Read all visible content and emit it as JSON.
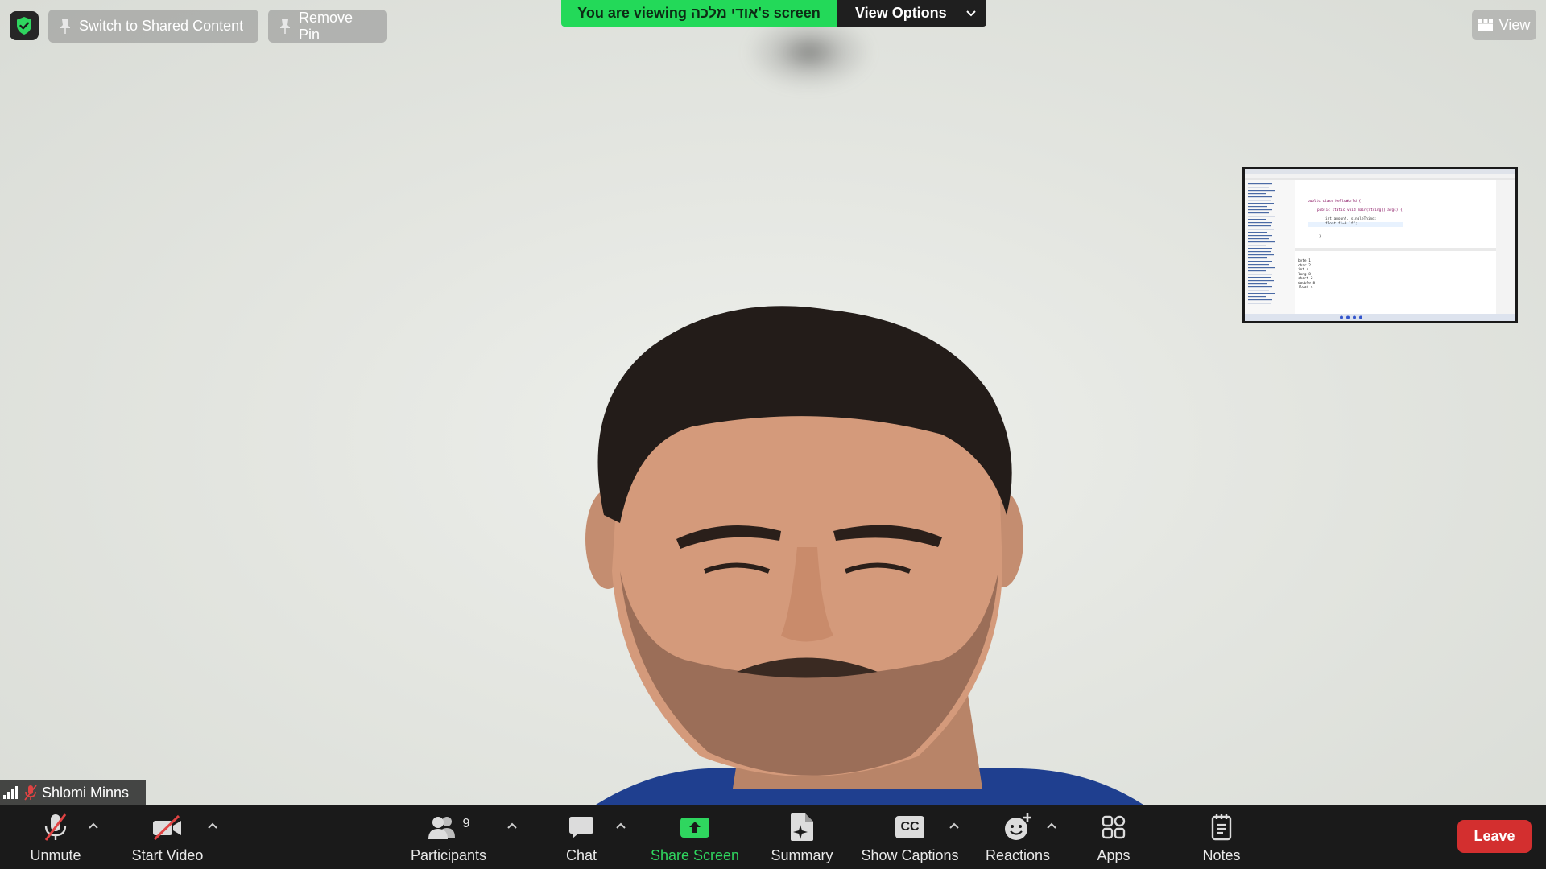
{
  "top_bar": {
    "switch_label": "Switch to Shared Content",
    "remove_pin_label": "Remove Pin",
    "banner_text": "You are viewing אודי מלכה's screen",
    "view_options_label": "View Options",
    "view_label": "View"
  },
  "participant": {
    "name": "Shlomi Minns"
  },
  "thumbnail": {
    "code_lines": [
      "public class HelloWorld {",
      "public static void main(String[] args) {",
      "int amount, singleThing;",
      "float f1=0.1ff;",
      "}"
    ],
    "console_lines": [
      "byte 1",
      "char 2",
      "int 4",
      "long 8",
      "short 2",
      "double 8",
      "float 4"
    ]
  },
  "toolbar": {
    "unmute": "Unmute",
    "start_video": "Start Video",
    "participants": "Participants",
    "participants_count": "9",
    "chat": "Chat",
    "share_screen": "Share Screen",
    "summary": "Summary",
    "captions": "Show Captions",
    "captions_icon_text": "CC",
    "reactions": "Reactions",
    "apps": "Apps",
    "notes": "Notes",
    "leave": "Leave"
  },
  "colors": {
    "banner_green": "#23d959",
    "share_green": "#2fd65f",
    "leave_red": "#d32f2f",
    "toolbar_bg": "#1a1a1a"
  }
}
